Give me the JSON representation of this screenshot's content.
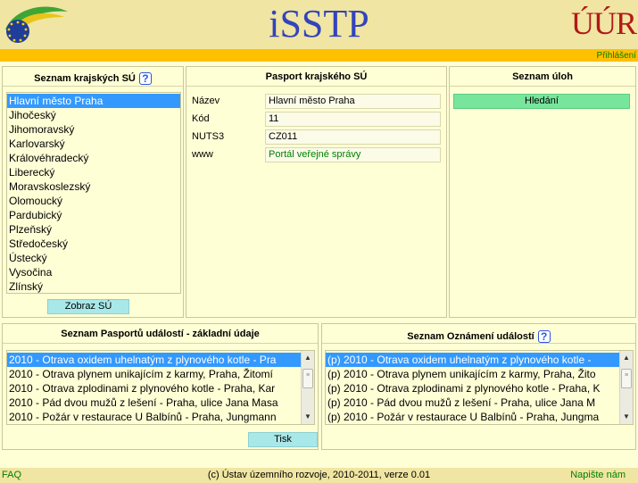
{
  "header": {
    "app_title": "iSSTP",
    "right_logo_text": "ÚÚR",
    "login_link": "Přihlášení"
  },
  "regions_panel": {
    "title": "Seznam krajských SÚ",
    "items": [
      {
        "label": "Hlavní město Praha",
        "selected": true
      },
      {
        "label": "Jihočeský"
      },
      {
        "label": "Jihomoravský"
      },
      {
        "label": "Karlovarský"
      },
      {
        "label": "Královéhradecký"
      },
      {
        "label": "Liberecký"
      },
      {
        "label": "Moravskoslezský"
      },
      {
        "label": "Olomoucký"
      },
      {
        "label": "Pardubický"
      },
      {
        "label": "Plzeňský"
      },
      {
        "label": "Středočeský"
      },
      {
        "label": "Ústecký"
      },
      {
        "label": "Vysočina"
      },
      {
        "label": "Zlínský"
      }
    ],
    "button_label": "Zobraz SÚ"
  },
  "passport_panel": {
    "title": "Pasport krajského SÚ",
    "rows": [
      {
        "label": "Název",
        "value": "Hlavní město Praha"
      },
      {
        "label": "Kód",
        "value": "11"
      },
      {
        "label": "NUTS3",
        "value": "CZ011"
      },
      {
        "label": "www",
        "value": "Portál veřejné správy",
        "is_link": true
      }
    ]
  },
  "tasks_panel": {
    "title": "Seznam úloh",
    "button_label": "Hledání"
  },
  "events_panel": {
    "title": "Seznam Pasportů událostí - základní údaje",
    "items": [
      {
        "label": "2010 - Otrava oxidem uhelnatým z plynového kotle - Pra",
        "selected": true
      },
      {
        "label": "2010 - Otrava plynem unikajícím z karmy, Praha, Žitomí"
      },
      {
        "label": "2010 - Otrava zplodinami z plynového kotle - Praha, Kar"
      },
      {
        "label": "2010 - Pád dvou mužů z lešení - Praha, ulice Jana Masa"
      },
      {
        "label": "2010 - Požár v restaurace U Balbínů - Praha, Jungmann"
      }
    ],
    "button_label": "Tisk"
  },
  "notices_panel": {
    "title": "Seznam Oznámení událostí",
    "items": [
      {
        "label": "(p) 2010 - Otrava oxidem uhelnatým z plynového kotle - ",
        "selected": true
      },
      {
        "label": "(p) 2010 - Otrava plynem unikajícím z karmy, Praha, Žito"
      },
      {
        "label": "(p) 2010 - Otrava zplodinami z plynového kotle - Praha, K"
      },
      {
        "label": "(p) 2010 - Pád dvou mužů z lešení - Praha, ulice Jana M"
      },
      {
        "label": "(p) 2010 - Požár v restaurace U Balbínů - Praha, Jungma"
      }
    ]
  },
  "footer": {
    "faq": "FAQ",
    "copyright": "(c) Ústav územního rozvoje, 2010-2011, verze 0.01",
    "contact": "Napište nám"
  },
  "colors": {
    "background": "#ffffd6",
    "header": "#f0e5a2",
    "accent_bar": "#ffc000",
    "selection": "#3399ff",
    "title_blue": "#3344bb",
    "logo_red": "#b21818",
    "link_green": "#008000",
    "button_cyan": "#a9e8e8",
    "button_green": "#77e69c"
  }
}
